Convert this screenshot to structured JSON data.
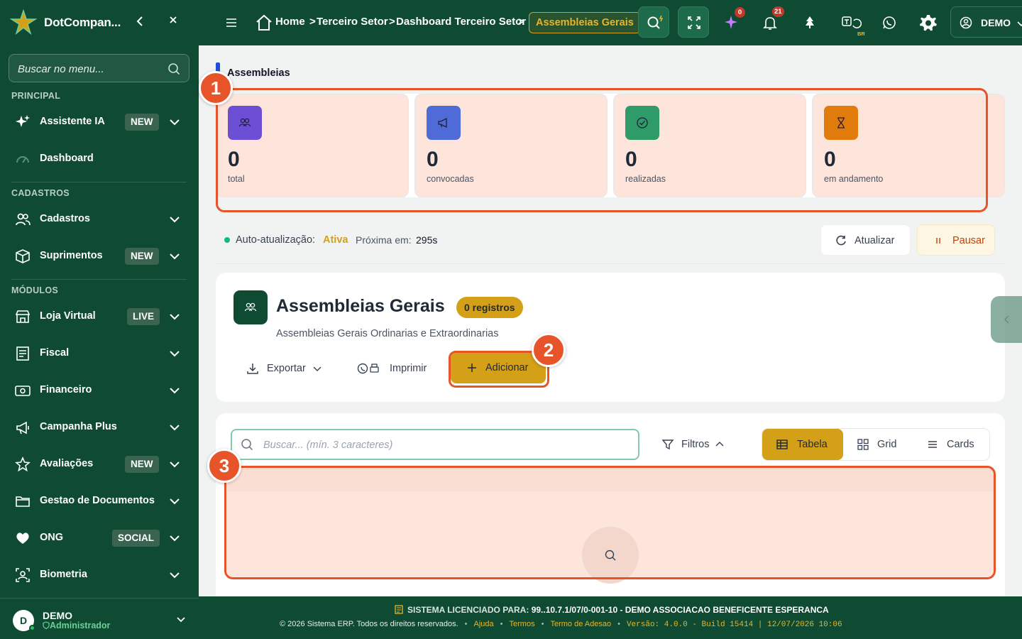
{
  "sidebar": {
    "brand": "DotCompan...",
    "search_placeholder": "Buscar no menu...",
    "sections": {
      "principal": "PRINCIPAL",
      "cadastros": "CADASTROS",
      "modulos": "MÓDULOS"
    },
    "items": [
      {
        "label": "Assistente IA",
        "badge": "NEW",
        "icon": "sparkle-icon"
      },
      {
        "label": "Dashboard",
        "icon": "gauge-icon"
      },
      {
        "label": "Cadastros",
        "icon": "users-icon"
      },
      {
        "label": "Suprimentos",
        "badge": "NEW",
        "icon": "box-icon"
      },
      {
        "label": "Loja Virtual",
        "badge": "LIVE",
        "icon": "store-icon"
      },
      {
        "label": "Fiscal",
        "icon": "receipt-icon"
      },
      {
        "label": "Financeiro",
        "icon": "money-icon"
      },
      {
        "label": "Campanha Plus",
        "icon": "megaphone-icon"
      },
      {
        "label": "Avaliações",
        "badge": "NEW",
        "icon": "star-icon"
      },
      {
        "label": "Gestao de Documentos",
        "icon": "folder-icon"
      },
      {
        "label": "ONG",
        "badge": "SOCIAL",
        "icon": "heart-icon"
      },
      {
        "label": "Biometria",
        "icon": "face-scan-icon"
      }
    ],
    "user": {
      "initial": "D",
      "name": "DEMO",
      "role": "Administrador"
    }
  },
  "topbar": {
    "breadcrumb": [
      "Home",
      "Terceiro Setor",
      "Dashboard Terceiro Setor"
    ],
    "current": "Assembleias Gerais",
    "ai_count": "0",
    "notif_count": "21",
    "lang_tag": "BR",
    "user_label": "DEMO"
  },
  "page": {
    "title": "Assembleias"
  },
  "stats": [
    {
      "value": "0",
      "label": "total",
      "color": "#6d4fd6",
      "icon": "users-icon"
    },
    {
      "value": "0",
      "label": "convocadas",
      "color": "#4f6bd8",
      "icon": "megaphone-icon"
    },
    {
      "value": "0",
      "label": "realizadas",
      "color": "#2f9b69",
      "icon": "check-circle-icon"
    },
    {
      "value": "0",
      "label": "em andamento",
      "color": "#e07b0c",
      "icon": "hourglass-icon"
    }
  ],
  "auto_refresh": {
    "label": "Auto-atualização:",
    "status": "Ativa",
    "next_label": "Próxima em:",
    "next_value": "295s",
    "refresh_label": "Atualizar",
    "pause_label": "Pausar"
  },
  "card": {
    "title": "Assembleias Gerais",
    "badge": "0 registros",
    "subtitle": "Assembleias Gerais Ordinarias e Extraordinarias",
    "export_label": "Exportar",
    "print_label": "Imprimir",
    "add_label": "Adicionar"
  },
  "list": {
    "search_placeholder": "Buscar... (mín. 3 caracteres)",
    "filters_label": "Filtros",
    "views": [
      "Tabela",
      "Grid",
      "Cards"
    ],
    "active_view": "Tabela"
  },
  "markers": [
    "1",
    "2",
    "3"
  ],
  "footer": {
    "license_label": "SISTEMA LICENCIADO PARA:",
    "license_value": "99..10.7.1/07/0-001-10 - DEMO ASSOCIACAO BENEFICENTE ESPERANCA",
    "copyright": "© 2026 Sistema ERP. Todos os direitos reservados.",
    "links": [
      "Ajuda",
      "Termos",
      "Termo de Adesao"
    ],
    "version": "Versão: 4.0.0 - Build 15414 | 12/07/2026 10:06"
  },
  "colors": {
    "primary": "#0f4a33",
    "accent": "#d4a017",
    "highlight": "#e8542a"
  }
}
